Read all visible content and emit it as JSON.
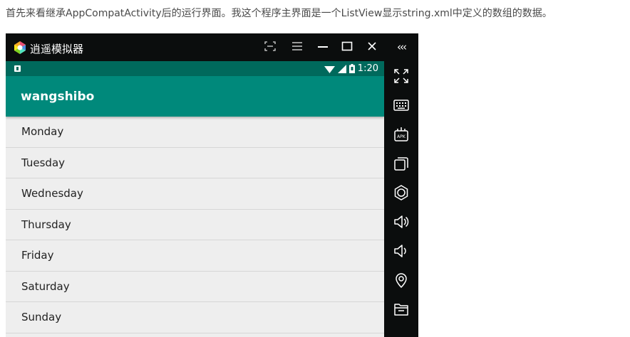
{
  "article": {
    "text": "首先来看继承AppCompatActivity后的运行界面。我这个程序主界面是一个ListView显示string.xml中定义的数组的数据。"
  },
  "emulator": {
    "window_title": "逍遥模拟器",
    "titlebar_buttons": [
      "fullscreen-capture",
      "menu",
      "minimize",
      "maximize",
      "close"
    ],
    "sidebar_collapse": "‹‹‹",
    "sidebar_icons": [
      "expand-icon",
      "keyboard-icon",
      "apk-install-icon",
      "multi-window-icon",
      "settings-icon",
      "volume-up-icon",
      "volume-down-icon",
      "location-icon",
      "folder-icon"
    ]
  },
  "android": {
    "status_time": "1:20",
    "toolbar_title": "wangshibo",
    "list_items": [
      "Monday",
      "Tuesday",
      "Wednesday",
      "Thursday",
      "Friday",
      "Saturday",
      "Sunday"
    ]
  },
  "colors": {
    "status_bar": "#00695c",
    "toolbar": "#00897b",
    "list_background": "#eeeeee",
    "emulator_frame": "#0b0d0d"
  }
}
